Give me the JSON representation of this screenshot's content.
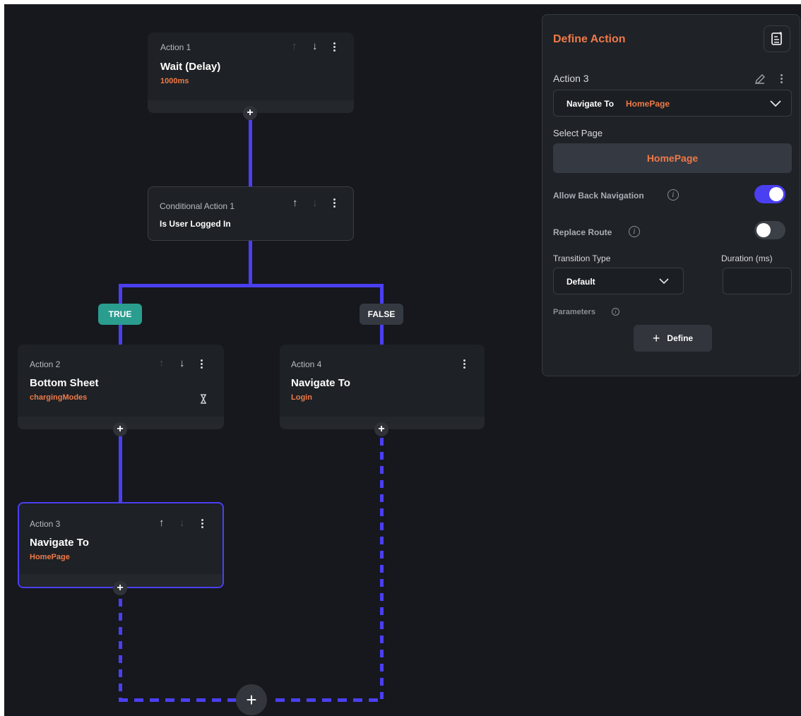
{
  "canvas": {
    "action1": {
      "label": "Action 1",
      "title": "Wait (Delay)",
      "subtitle": "1000ms"
    },
    "conditional": {
      "label": "Conditional Action 1",
      "title": "Is User Logged In"
    },
    "true_badge": "TRUE",
    "false_badge": "FALSE",
    "action2": {
      "label": "Action 2",
      "title": "Bottom Sheet",
      "subtitle": "chargingModes",
      "icon": "hourglass-icon"
    },
    "action4": {
      "label": "Action 4",
      "title": "Navigate To",
      "subtitle": "Login"
    },
    "action3": {
      "label": "Action 3",
      "title": "Navigate To",
      "subtitle": "HomePage"
    },
    "add_symbol": "+",
    "up_arrow": "↑",
    "down_arrow": "↓",
    "colors": {
      "accent": "#4b3ff2",
      "orange": "#ee7a49",
      "true_badge": "#2a9d8f",
      "false_badge": "#353a42"
    }
  },
  "panel": {
    "title": "Define Action",
    "action_name": "Action 3",
    "dropdown": {
      "action": "Navigate To",
      "target": "HomePage"
    },
    "select_page_label": "Select Page",
    "selected_page": "HomePage",
    "allow_back": {
      "label": "Allow Back Navigation",
      "on": true
    },
    "replace_route": {
      "label": "Replace Route",
      "on": false
    },
    "transition_type": {
      "label": "Transition Type",
      "value": "Default"
    },
    "duration": {
      "label": "Duration (ms)",
      "value": ""
    },
    "parameters_label": "Parameters",
    "define_button": "Define",
    "define_plus": "+",
    "info_glyph": "i"
  }
}
